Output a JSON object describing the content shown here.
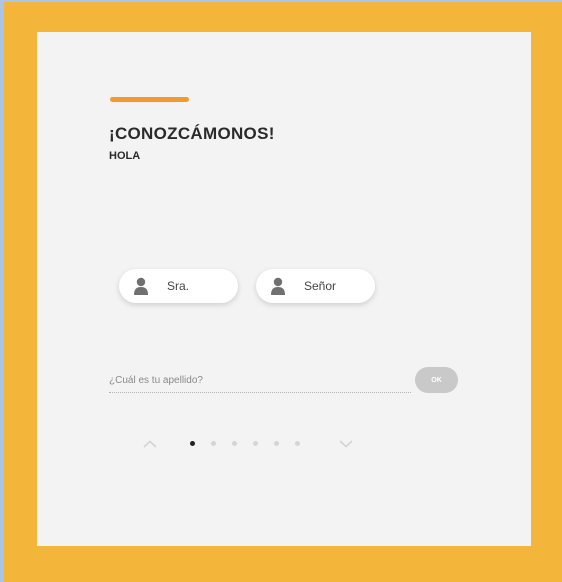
{
  "intro": {
    "title": "¡CONOZCÁMONOS!",
    "subtitle": "HOLA"
  },
  "gender_options": [
    {
      "label": "Sra.",
      "icon": "person-silhouette-icon"
    },
    {
      "label": "Señor",
      "icon": "person-silhouette-icon"
    }
  ],
  "surname_field": {
    "placeholder": "¿Cuál es tu apellido?",
    "value": ""
  },
  "ok_button": {
    "label": "OK"
  },
  "pagination": {
    "total": 6,
    "current": 1
  },
  "colors": {
    "background": "#f4b63a",
    "card": "#f3f3f3",
    "accent": "#f39a2e",
    "ok_button": "#c9c9c9"
  }
}
